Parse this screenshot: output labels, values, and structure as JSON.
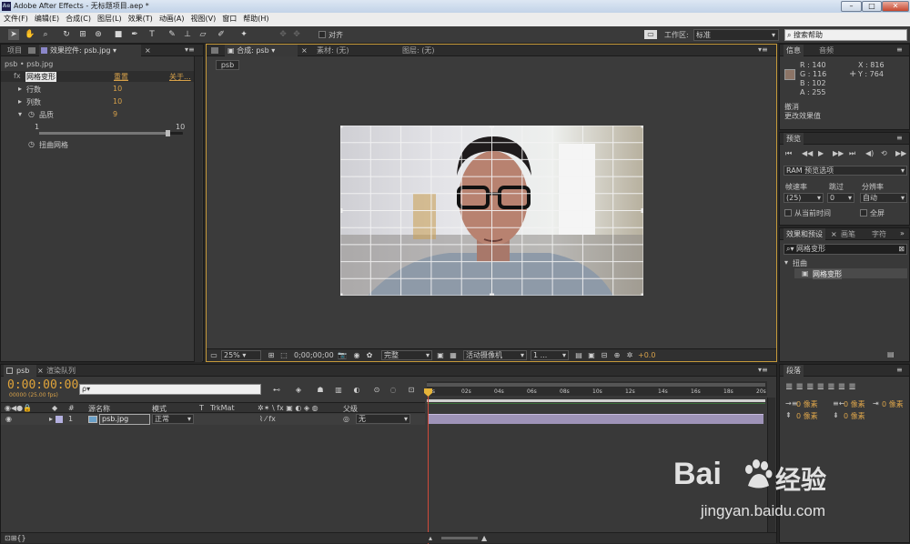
{
  "titlebar": {
    "title": "Adobe After Effects - 无标题项目.aep *",
    "app_icon": "Ae"
  },
  "menu": [
    "文件(F)",
    "编辑(E)",
    "合成(C)",
    "图层(L)",
    "效果(T)",
    "动画(A)",
    "视图(V)",
    "窗口",
    "帮助(H)"
  ],
  "toolbar": {
    "align_label": "对齐",
    "workspace_label": "工作区:",
    "workspace_value": "标准",
    "search_help": "搜索帮助"
  },
  "left_panel": {
    "tab_project": "项目",
    "tab_effects": "效果控件: psb.jpg",
    "breadcrumb": "psb • psb.jpg",
    "effect_name": "网格变形",
    "reset": "重置",
    "about": "关于...",
    "rows_label": "行数",
    "rows_value": "10",
    "cols_label": "列数",
    "cols_value": "10",
    "quality_label": "品质",
    "quality_value": "9",
    "slider_min": "1",
    "slider_max": "10",
    "slider_level": 0.9,
    "warp_label": "扭曲网格"
  },
  "comp_panel": {
    "tab_comp": "合成: psb",
    "tab_footage": "素材: (无)",
    "tab_layer": "图层: (无)",
    "comp_chip": "psb",
    "zoom": "25%",
    "timecode": "0;00;00;00",
    "resolution": "完整",
    "camera": "活动摄像机",
    "views": "1 ...",
    "exposure": "+0.0"
  },
  "info_panel": {
    "tab_info": "信息",
    "tab_audio": "音频",
    "swatch_color": "#8c7466",
    "r": "R : 140",
    "g": "G : 116",
    "b": "B : 102",
    "a": "A : 255",
    "x": "X : 816",
    "y": "Y : 764",
    "undo1": "撤消",
    "undo2": "更改效果值"
  },
  "preview_panel": {
    "tab": "预览",
    "ram_options": "RAM 预览选项",
    "framerate_label": "帧速率",
    "skip_label": "跳过",
    "res_label": "分辨率",
    "framerate_value": "(25)",
    "skip_value": "0",
    "res_value": "自动",
    "from_current": "从当前时间",
    "fullscreen": "全屏"
  },
  "effects_panel": {
    "tab_effects": "效果和预设",
    "tab_brush": "画笔",
    "tab_char": "字符",
    "search_value": "网格变形",
    "category": "扭曲",
    "item": "网格变形"
  },
  "para_panel": {
    "tab": "段落",
    "px1": "0 像素",
    "px2": "0 像素",
    "px3": "0 像素",
    "px4": "0 像素",
    "px5": "0 像素"
  },
  "timeline": {
    "tab_comp": "psb",
    "tab_render": "渲染队列",
    "timecode": "0:00:00:00",
    "fps": "00000 (25.00 fps)",
    "search_placeholder": "ρ▾",
    "col_source": "源名称",
    "col_mode": "模式",
    "col_t": "T",
    "col_trkmat": "TrkMat",
    "col_parent": "父级",
    "layer_num": "1",
    "layer_name": "psb.jpg",
    "layer_mode": "正常",
    "layer_parent": "无",
    "ruler": [
      "0s",
      "02s",
      "04s",
      "06s",
      "08s",
      "10s",
      "12s",
      "14s",
      "16s",
      "18s",
      "20s"
    ]
  },
  "watermark": {
    "brand": "Bai",
    "brand2": "经验",
    "url": "jingyan.baidu.com"
  }
}
